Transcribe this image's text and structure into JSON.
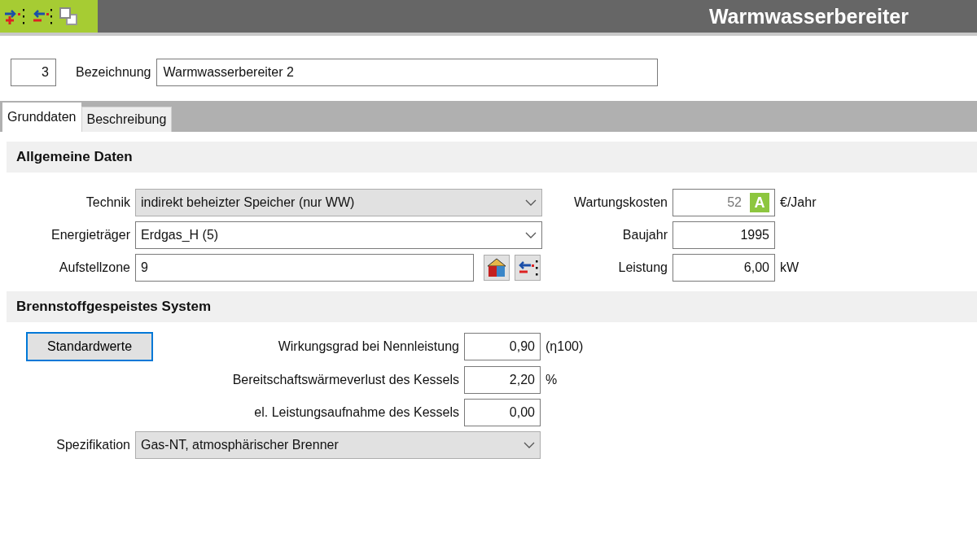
{
  "header": {
    "title": "Warmwasserbereiter"
  },
  "record": {
    "number": "3",
    "name_label": "Bezeichnung",
    "name_value": "Warmwasserbereiter 2"
  },
  "tabs": [
    {
      "label": "Grunddaten",
      "selected": true
    },
    {
      "label": "Beschreibung",
      "selected": false
    }
  ],
  "general": {
    "title": "Allgemeine Daten",
    "fields": [
      {
        "kind": "select",
        "label": "Technik",
        "value": "indirekt beheizter Speicher (nur WW)",
        "disabled": true
      },
      {
        "kind": "select",
        "label": "Energieträger",
        "value": "Erdgas_H (5)",
        "disabled": false
      },
      {
        "kind": "zone",
        "label": "Aufstellzone",
        "value": "9"
      }
    ],
    "side_fields": [
      {
        "label": "Wartungskosten",
        "value": "52",
        "badge": "A",
        "unit": "€/Jahr"
      },
      {
        "label": "Baujahr",
        "value": "1995"
      },
      {
        "label": "Leistung",
        "value": "6,00",
        "unit": "kW"
      }
    ]
  },
  "fuel_system": {
    "title": "Brennstoffgespeistes System",
    "button": "Standardwerte",
    "params": [
      {
        "label": "Wirkungsgrad bei Nennleistung",
        "value": "0,90",
        "unit": "(η100)"
      },
      {
        "label": "Bereitschaftswärmeverlust des Kessels",
        "value": "2,20",
        "unit": "%"
      },
      {
        "label": "el. Leistungsaufnahme des Kessels",
        "value": "0,00"
      }
    ],
    "specification": {
      "label": "Spezifikation",
      "value": "Gas-NT, atmosphärischer Brenner",
      "disabled": true
    }
  }
}
